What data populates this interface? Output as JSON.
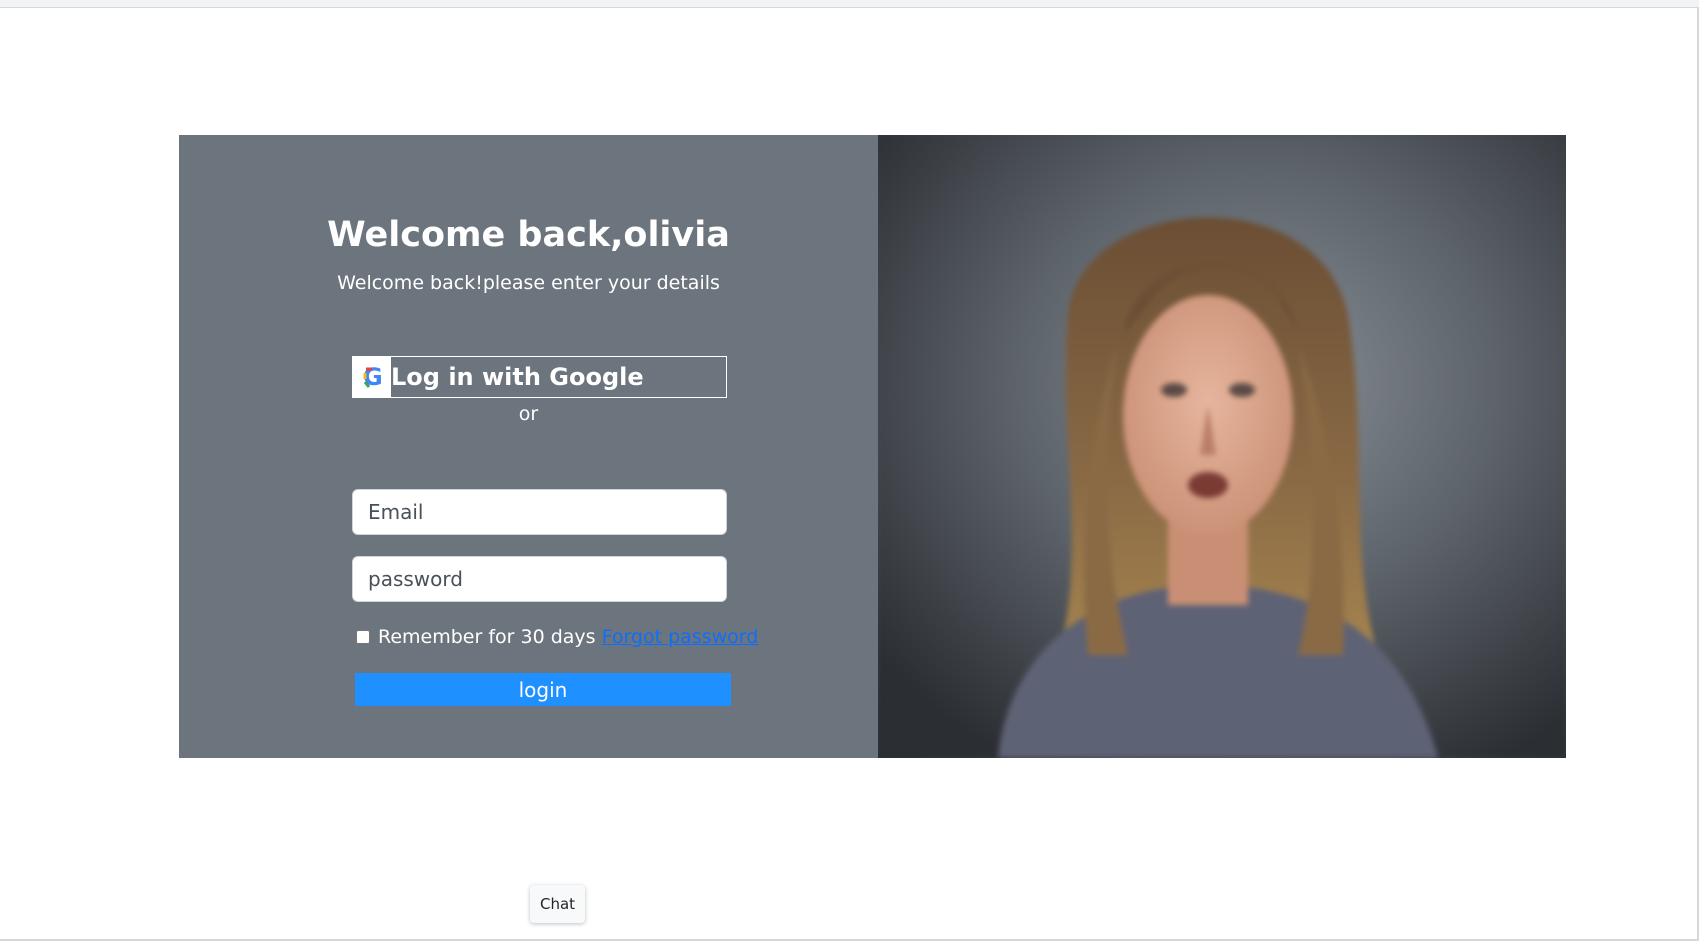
{
  "login": {
    "title": "Welcome back,olivia",
    "subtitle": "Welcome back!please enter your details",
    "google_button_label": "Log in with Google",
    "or_text": "or",
    "email_placeholder": "Email",
    "password_placeholder": "password",
    "remember_label": "Remember for 30 days",
    "forgot_password_link": "Forgot password",
    "login_button_label": "login"
  },
  "chat": {
    "label": "Chat"
  },
  "colors": {
    "form_panel_bg": "#6c757d",
    "login_button_bg": "#1e90ff",
    "link": "#0d6efd"
  },
  "icons": {
    "google": "google-logo-icon"
  }
}
